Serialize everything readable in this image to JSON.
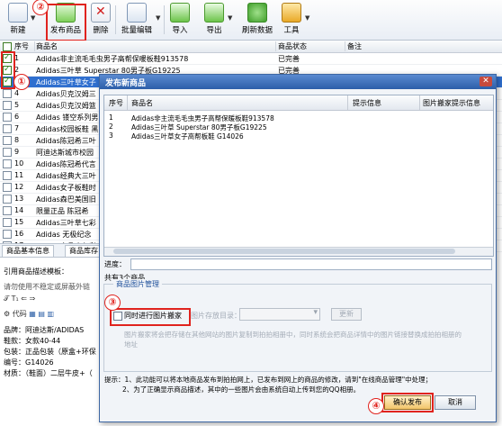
{
  "toolbar": {
    "items": [
      {
        "label": "新建",
        "icon": "new-icon"
      },
      {
        "label": "发布商品",
        "icon": "publish-icon"
      },
      {
        "label": "删除",
        "icon": "delete-icon"
      },
      {
        "label": "批量编辑",
        "icon": "batch-edit-icon"
      },
      {
        "label": "导入",
        "icon": "import-icon"
      },
      {
        "label": "导出",
        "icon": "export-icon"
      },
      {
        "label": "刷新数据",
        "icon": "refresh-icon"
      },
      {
        "label": "工具",
        "icon": "tools-icon"
      }
    ]
  },
  "annotations": [
    "②",
    "①",
    "③",
    "④"
  ],
  "main_list": {
    "headers": {
      "num": "序号",
      "name": "商品名",
      "status": "商品状态",
      "note": "备注"
    },
    "rows": [
      {
        "num": "1",
        "name": "Adidas非主流毛毛虫男子高帮保暖板鞋913578",
        "status": "已完善",
        "checked": true
      },
      {
        "num": "2",
        "name": "Adidas三叶草 Superstar 80男子板G19225",
        "status": "已完善",
        "checked": true
      },
      {
        "num": "3",
        "name": "Adidas三叶草女子",
        "status": "",
        "checked": true
      },
      {
        "num": "4",
        "name": "Adidas贝克汉姆三",
        "status": "",
        "checked": false
      },
      {
        "num": "5",
        "name": "Adidas贝克汉姆篮",
        "status": "",
        "checked": false
      },
      {
        "num": "6",
        "name": "Adidas 镂空系列男",
        "status": "",
        "checked": false
      },
      {
        "num": "7",
        "name": "Adidas校园板鞋 黑",
        "status": "",
        "checked": false
      },
      {
        "num": "8",
        "name": "Adidas陈冠希三叶",
        "status": "",
        "checked": false
      },
      {
        "num": "9",
        "name": "阿迪达斯城市校园",
        "status": "",
        "checked": false
      },
      {
        "num": "10",
        "name": "Adidas陈冠希代言",
        "status": "",
        "checked": false
      },
      {
        "num": "11",
        "name": "Adidas经典大三叶",
        "status": "",
        "checked": false
      },
      {
        "num": "12",
        "name": "Adidas女子板鞋时",
        "status": "",
        "checked": false
      },
      {
        "num": "13",
        "name": "Adidas森巴美国旧",
        "status": "",
        "checked": false
      },
      {
        "num": "14",
        "name": "限量正品 陈冠希",
        "status": "",
        "checked": false
      },
      {
        "num": "15",
        "name": "Adidas三叶草七彩",
        "status": "",
        "checked": false
      },
      {
        "num": "16",
        "name": "Adidas 无极纪念",
        "status": "",
        "checked": false
      },
      {
        "num": "17",
        "name": "Adidas水晶底七彩",
        "status": "",
        "checked": false
      }
    ]
  },
  "lower_panel": {
    "tabs": [
      "商品基本信息",
      "商品库存"
    ],
    "template_label": "引用商品描述模板：",
    "warning": "请勿使用不稳定或屏蔽外链",
    "code_label": "代码",
    "desc_lines": [
      "品牌：阿迪达斯/ADIDAS",
      "鞋款：女款40-44",
      "包装：正品包装（原盒+环保",
      "编号：G14026",
      "材质：（鞋面）二层牛皮+（"
    ]
  },
  "dialog": {
    "title": "发布新商品",
    "close": "✕",
    "grid_headers": {
      "num": "序号",
      "name": "商品名",
      "tip": "提示信息",
      "img_tip": "图片搬家提示信息"
    },
    "rows": [
      {
        "num": "1",
        "name": "Adidas非主流毛毛虫男子高帮保暖板鞋913578"
      },
      {
        "num": "2",
        "name": "Adidas三叶草 Superstar 80男子板G19225"
      },
      {
        "num": "3",
        "name": "Adidas三叶草女子高帮板鞋 G14026"
      }
    ],
    "progress_label": "进度：",
    "total": "共有3个商品",
    "group_title": "商品图片管理",
    "checkbox_label": "同时进行图片搬家",
    "dir_label": "图片存放目录：",
    "change_button": "更新",
    "note": "图片搬家将会把存储在其他网站的图片复制到拍拍相册中，同时系统会把商品详情中的图片链接替换成拍拍相册的地址",
    "tips_1": "提示：1、此功能可以将本地商品发布到拍拍网上，已发布到网上的商品的修改，请到\"在线商品管理\"中处理；",
    "tips_2": "2、为了正确显示商品描述，其中的一些图片会由系统自动上传到您的QQ相册。",
    "ok_button": "确认发布",
    "cancel_button": "取消"
  }
}
